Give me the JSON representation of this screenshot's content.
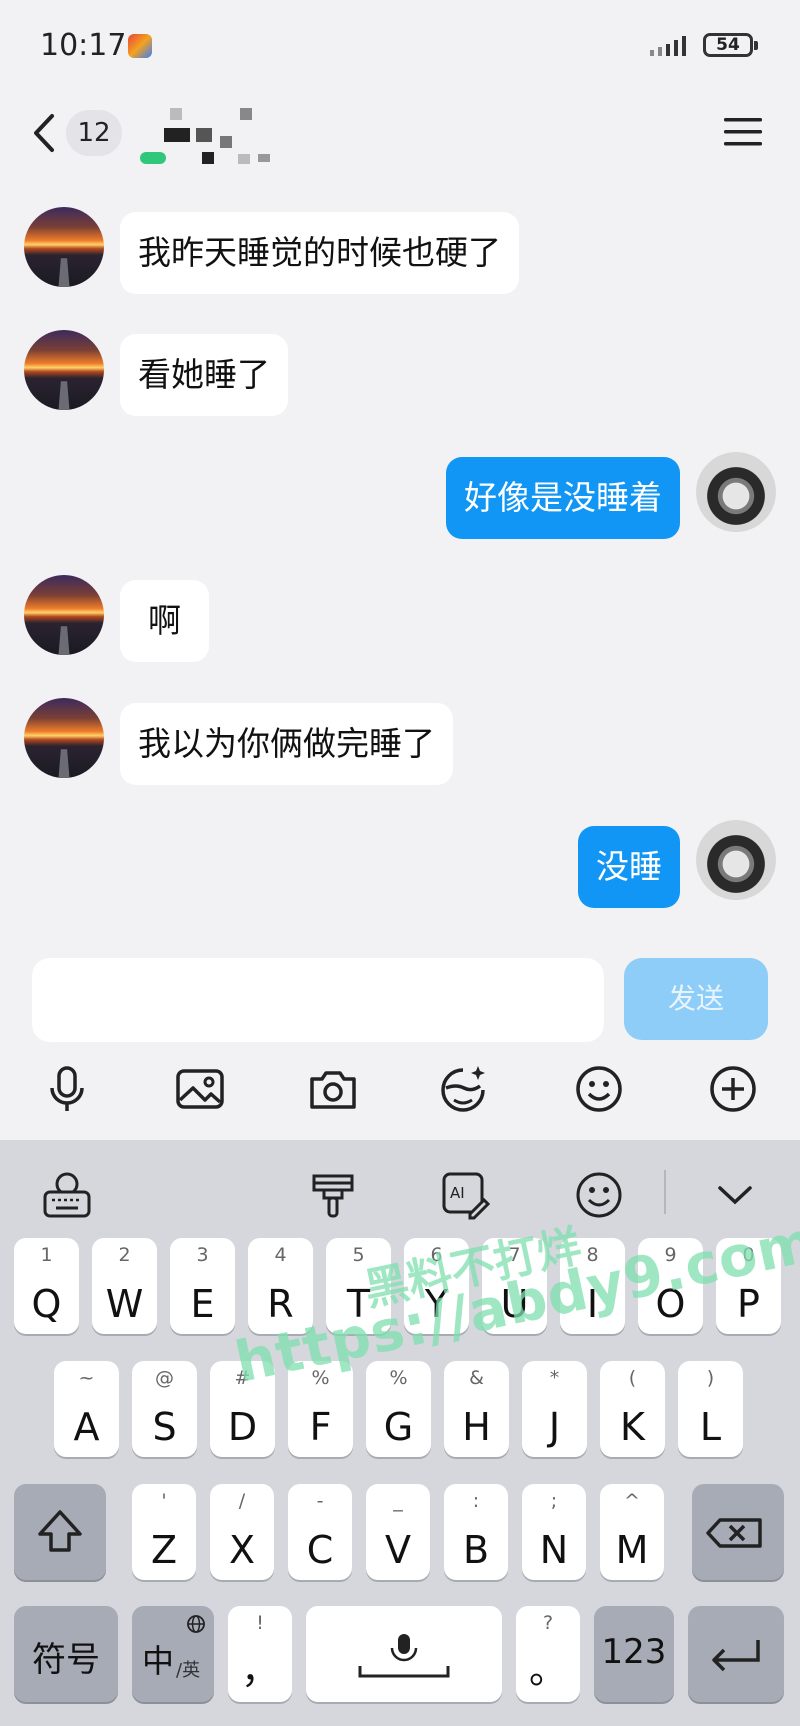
{
  "status_bar": {
    "time": "10:17",
    "battery": "54"
  },
  "header": {
    "unread_count": "12"
  },
  "messages": [
    {
      "side": "left",
      "text": "我昨天睡觉的时候也硬了"
    },
    {
      "side": "left",
      "text": "看她睡了"
    },
    {
      "side": "right",
      "text": "好像是没睡着"
    },
    {
      "side": "left",
      "text": "啊"
    },
    {
      "side": "left",
      "text": "我以为你俩做完睡了"
    },
    {
      "side": "right",
      "text": "没睡"
    }
  ],
  "input": {
    "value": "",
    "send_label": "发送"
  },
  "toolbar_icons": [
    "microphone-icon",
    "image-icon",
    "camera-icon",
    "sticker-edit-icon",
    "emoji-icon",
    "plus-icon"
  ],
  "keyboard": {
    "row1": [
      {
        "main": "Q",
        "hint": "1"
      },
      {
        "main": "W",
        "hint": "2"
      },
      {
        "main": "E",
        "hint": "3"
      },
      {
        "main": "R",
        "hint": "4"
      },
      {
        "main": "T",
        "hint": "5"
      },
      {
        "main": "Y",
        "hint": "6"
      },
      {
        "main": "U",
        "hint": "7"
      },
      {
        "main": "I",
        "hint": "8"
      },
      {
        "main": "O",
        "hint": "9"
      },
      {
        "main": "P",
        "hint": "0"
      }
    ],
    "row2": [
      {
        "main": "A",
        "hint": "~"
      },
      {
        "main": "S",
        "hint": "@"
      },
      {
        "main": "D",
        "hint": "#"
      },
      {
        "main": "F",
        "hint": "%"
      },
      {
        "main": "G",
        "hint": "%"
      },
      {
        "main": "H",
        "hint": "&"
      },
      {
        "main": "J",
        "hint": "*"
      },
      {
        "main": "K",
        "hint": "("
      },
      {
        "main": "L",
        "hint": ")"
      }
    ],
    "row3": [
      {
        "main": "Z",
        "hint": "'"
      },
      {
        "main": "X",
        "hint": "/"
      },
      {
        "main": "C",
        "hint": "-"
      },
      {
        "main": "V",
        "hint": "_"
      },
      {
        "main": "B",
        "hint": ":"
      },
      {
        "main": "N",
        "hint": ";"
      },
      {
        "main": "M",
        "hint": "^"
      }
    ],
    "symbols_label": "符号",
    "lang_label_main": "中",
    "lang_label_sub": "/英",
    "comma_key": "，",
    "comma_hint": "!",
    "period_key": "。",
    "period_hint": "?",
    "numbers_label": "123"
  },
  "watermark": {
    "cn": "黑料不打烊",
    "url": "https://abdy9.com"
  }
}
